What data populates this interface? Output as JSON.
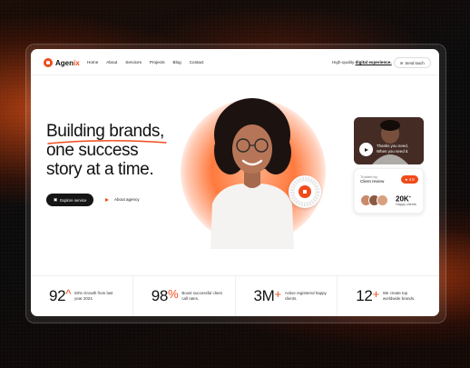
{
  "brand": {
    "name_main": "Agen",
    "name_accent": "ix",
    "accent_color": "#f04a1a"
  },
  "nav": {
    "links": [
      "Home",
      "About",
      "Services",
      "Projects",
      "Blog",
      "Contact"
    ],
    "tagline_prefix": "High-quality",
    "tagline_emphasis": "digital experience.",
    "send_button": "Send touch"
  },
  "hero": {
    "title_line1": "Building brands,",
    "title_line2": "one success",
    "title_line3": "story at a time.",
    "primary_button": "Explore service",
    "secondary_button": "About agency"
  },
  "video_card": {
    "line1": "Thanks you need,",
    "line2": "When you need it."
  },
  "trust_card": {
    "label": "Trusted by",
    "title": "Client review",
    "rating": "4.9",
    "count": "20K",
    "count_suffix": "+",
    "count_label": "Happy clients"
  },
  "stats": [
    {
      "value": "92",
      "suffix": "^",
      "text": "60% Growth from last year 2024."
    },
    {
      "value": "98",
      "suffix": "%",
      "text": "Boost successful client call rates."
    },
    {
      "value": "3M",
      "suffix": "+",
      "text": "Active registered happy clients."
    },
    {
      "value": "12",
      "suffix": "+",
      "text": "We create top worldwide brands."
    }
  ]
}
